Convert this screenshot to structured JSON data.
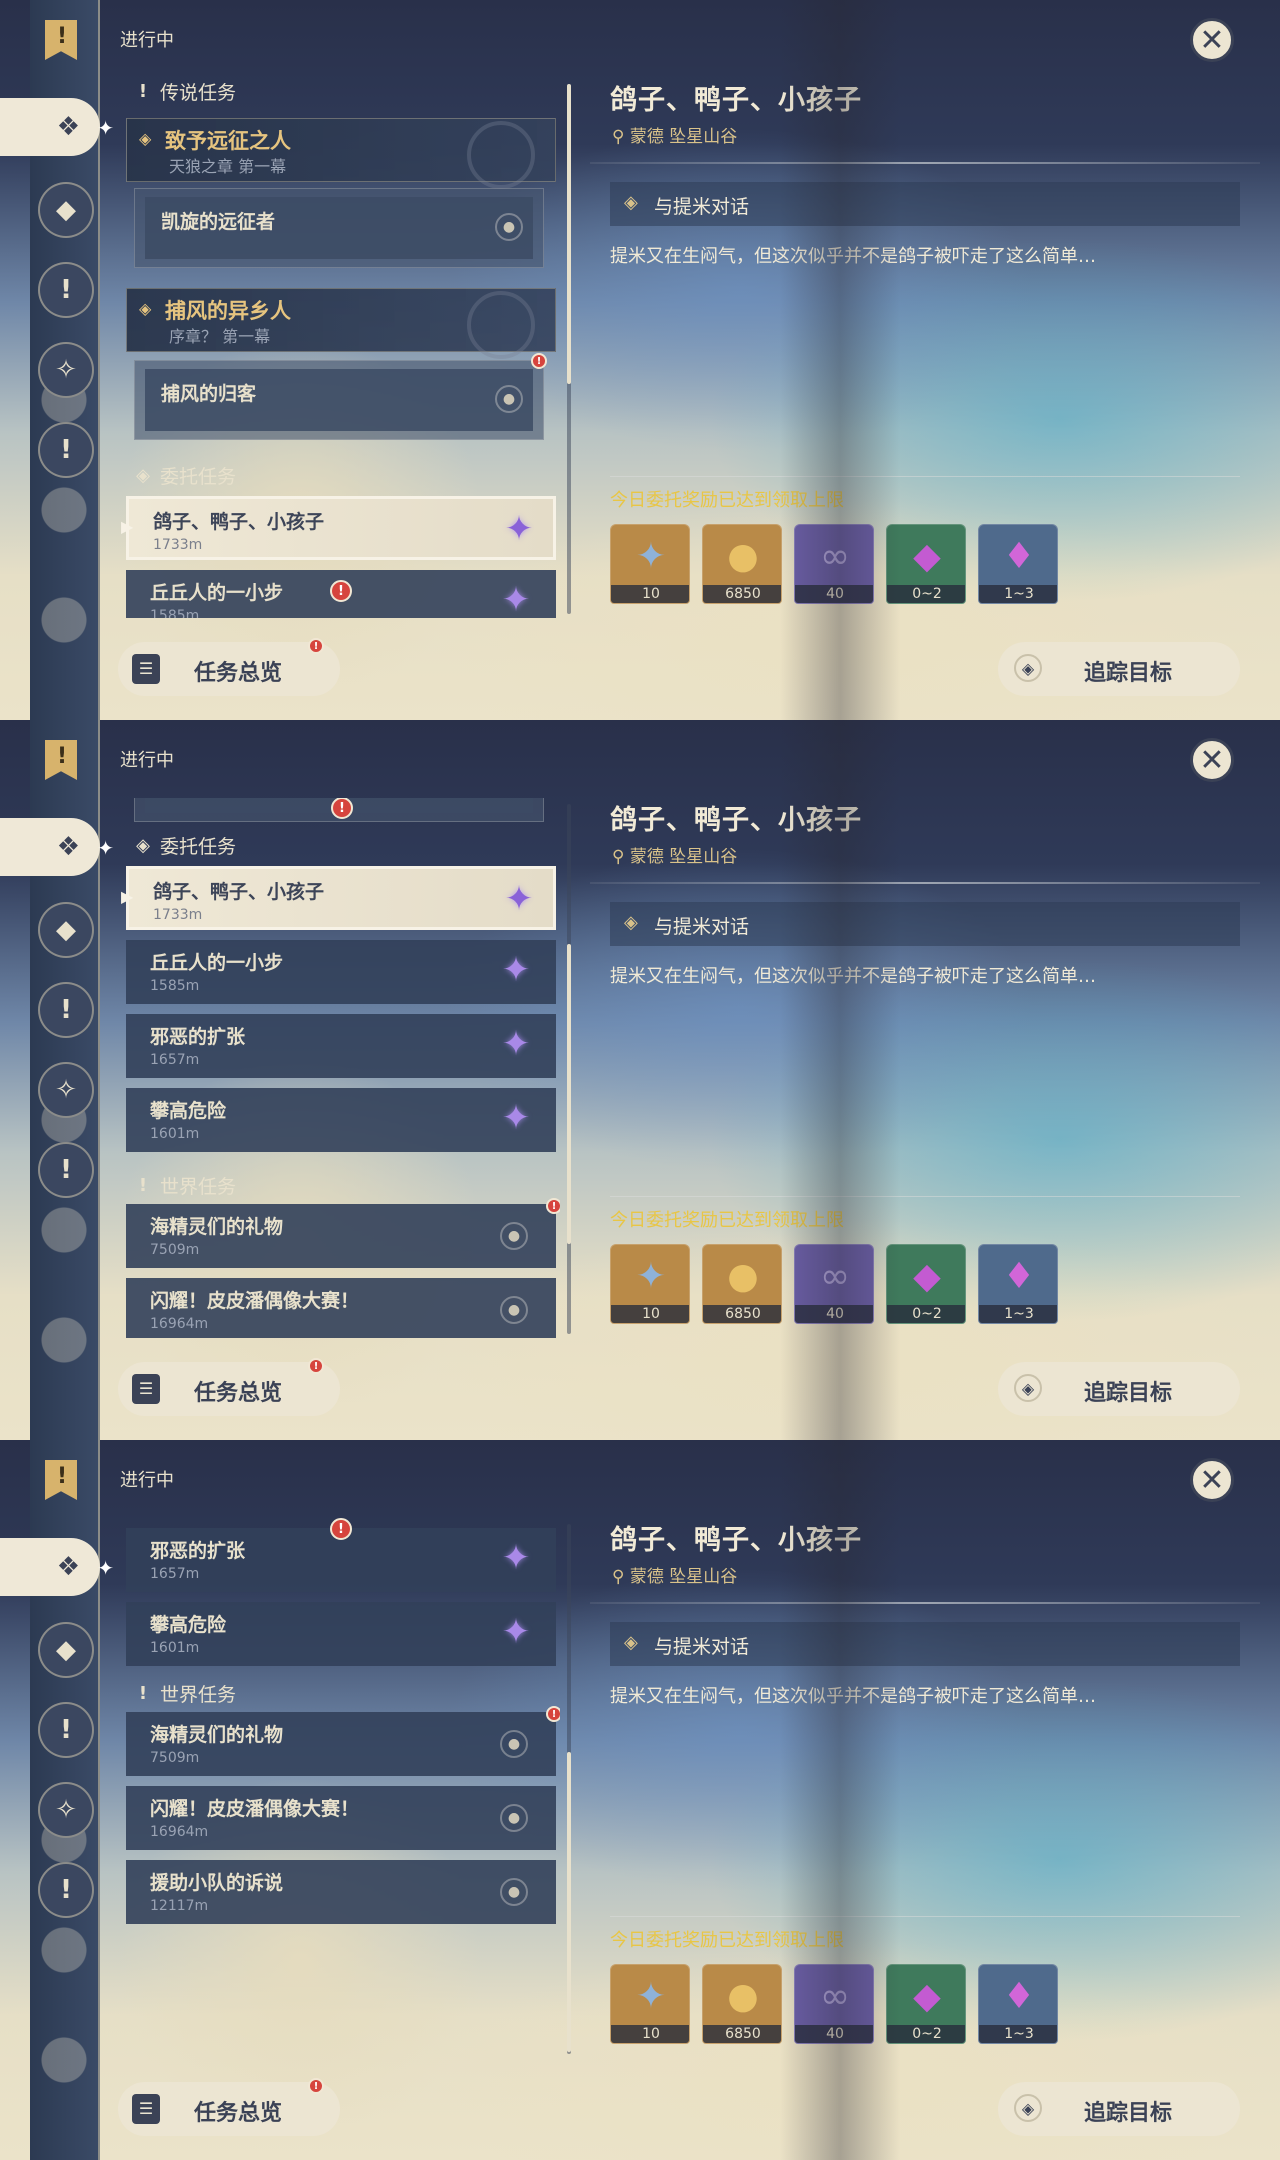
{
  "status_title": "进行中",
  "close_label": "✕",
  "sections": {
    "archon": "传说任务",
    "commission": "委托任务",
    "world": "世界任务"
  },
  "archon_quests": [
    {
      "title": "致予远征之人",
      "subtitle": "天狼之章 第一幕",
      "step": "凯旋的远征者"
    },
    {
      "title": "捕风的异乡人",
      "subtitle": "序章？ 第一幕",
      "step": "捕风的归客"
    }
  ],
  "commissions": [
    {
      "title": "鸽子、鸭子、小孩子",
      "distance": "1733m"
    },
    {
      "title": "丘丘人的一小步",
      "distance": "1585m"
    },
    {
      "title": "邪恶的扩张",
      "distance": "1657m"
    },
    {
      "title": "攀高危险",
      "distance": "1601m"
    }
  ],
  "world_quests": [
    {
      "title": "海精灵们的礼物",
      "distance": "7509m"
    },
    {
      "title": "闪耀！皮皮潘偶像大赛！",
      "distance": "16964m"
    },
    {
      "title": "援助小队的诉说",
      "distance": "12117m"
    }
  ],
  "detail": {
    "title": "鸽子、鸭子、小孩子",
    "location": "蒙德 坠星山谷",
    "objective": "与提米对话",
    "description": "提米又在生闷气，但这次似乎并不是鸽子被吓走了这么简单…",
    "reward_note": "今日委托奖励已达到领取上限",
    "rewards": [
      {
        "name": "intertwined-fate-icon",
        "qty": "10",
        "color": "#c08a3e"
      },
      {
        "name": "mora-icon",
        "qty": "6850",
        "color": "#c08a3e"
      },
      {
        "name": "companionship-exp-icon",
        "qty": "40",
        "color": "#6c5fa8"
      },
      {
        "name": "crystal-icon",
        "qty": "0~2",
        "color": "#3f7a5c"
      },
      {
        "name": "crystal-cluster-icon",
        "qty": "1~3",
        "color": "#4f6a8c"
      }
    ]
  },
  "buttons": {
    "overview": "任务总览",
    "track": "追踪目标"
  },
  "badge": "!",
  "colors": {
    "accent_gold": "#e6c47f",
    "reward_note": "#e8c646",
    "panel_light": "#ece5d2",
    "badge_red": "#d6443d",
    "star_purple": "#a989e8"
  }
}
